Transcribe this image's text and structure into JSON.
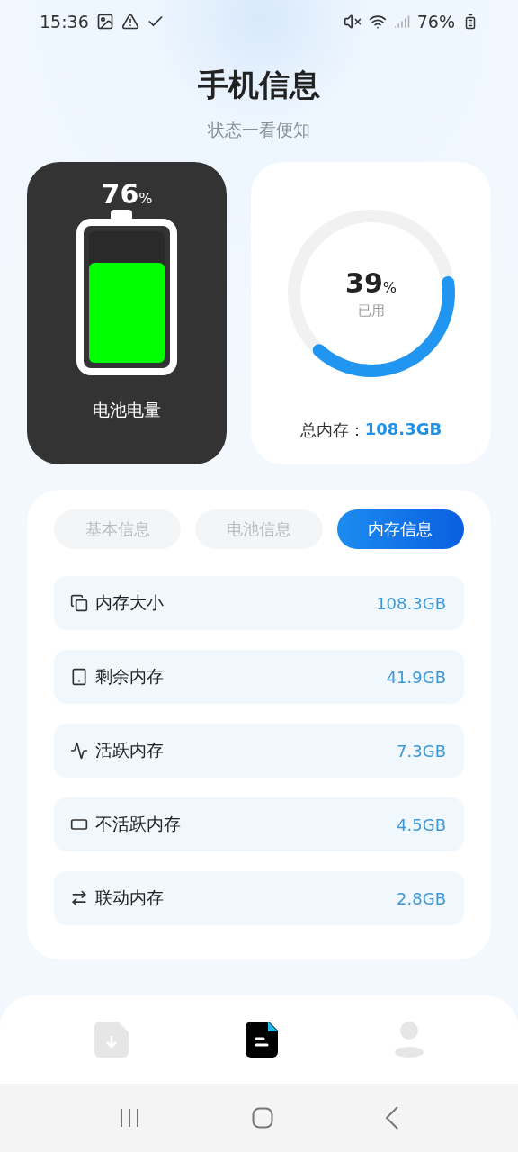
{
  "status_bar": {
    "time": "15:36",
    "battery": "76%"
  },
  "header": {
    "title": "手机信息",
    "subtitle": "状态一看便知"
  },
  "battery_card": {
    "percent": "76",
    "unit": "%",
    "level": 0.76,
    "label": "电池电量"
  },
  "memory_card": {
    "percent": "39",
    "unit": "%",
    "caption": "已用",
    "level": 0.39,
    "total_label": "总内存：",
    "total_value": "108.3GB"
  },
  "tabs": [
    {
      "label": "基本信息",
      "selected": false
    },
    {
      "label": "电池信息",
      "selected": false
    },
    {
      "label": "内存信息",
      "selected": true
    }
  ],
  "rows": [
    {
      "kind": "size",
      "label": "内存大小",
      "value": "108.3GB"
    },
    {
      "kind": "free",
      "label": "剩余内存",
      "value": "41.9GB"
    },
    {
      "kind": "active",
      "label": "活跃内存",
      "value": "7.3GB"
    },
    {
      "kind": "inactive",
      "label": "不活跃内存",
      "value": "4.5GB"
    },
    {
      "kind": "wired",
      "label": "联动内存",
      "value": "2.8GB"
    }
  ],
  "bottom_nav": [
    {
      "kind": "download",
      "selected": false
    },
    {
      "kind": "document",
      "selected": true
    },
    {
      "kind": "profile",
      "selected": false
    }
  ]
}
